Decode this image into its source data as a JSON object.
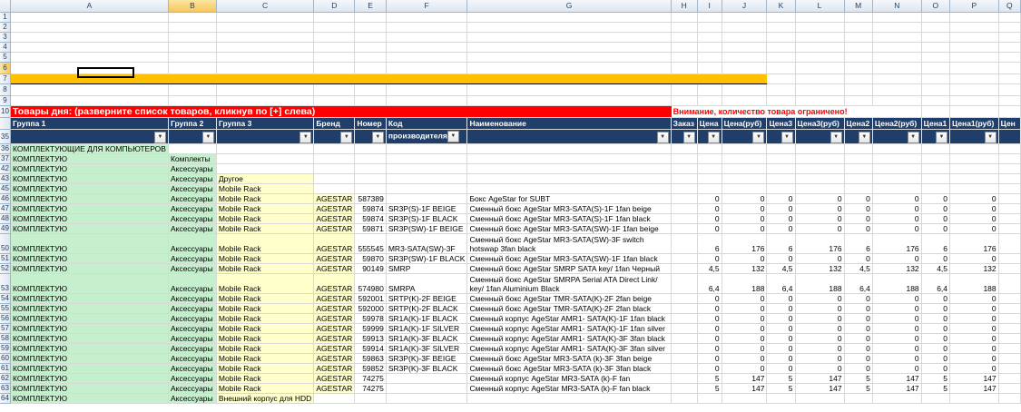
{
  "sheet": {
    "columns": [
      "A",
      "B",
      "C",
      "D",
      "E",
      "F",
      "G",
      "H",
      "I",
      "J",
      "K",
      "L",
      "M",
      "N",
      "O",
      "P",
      "Q"
    ],
    "top_rows": [
      "1",
      "2",
      "3",
      "4",
      "5",
      "6",
      "7",
      "8",
      "9"
    ],
    "banner": {
      "row": "10",
      "title": "Товары дня: (разверните список товаров, кликнув по [+] слева)",
      "warning": "Внимание, количество товара ограничено!"
    },
    "header_row": "35",
    "headers": [
      "Группа 1",
      "Группа 2",
      "Группа 3",
      "Бренд",
      "Номер",
      "Код производителя",
      "Наименование",
      "Заказ",
      "Цена",
      "Цена(руб)",
      "Цена3",
      "Цена3(руб)",
      "Цена2",
      "Цена2(руб)",
      "Цена1",
      "Цена1(руб)",
      "Цен"
    ],
    "filter_glyph": "▼",
    "rows": [
      {
        "n": "36",
        "a": "КОМПЛЕКТУЮЩИЕ ДЛЯ КОМПЬЮТЕРОВ",
        "b": "",
        "c": "",
        "d": "",
        "e": "",
        "f": "",
        "g": "",
        "h": "",
        "v": [
          "",
          "",
          "",
          "",
          "",
          "",
          "",
          ""
        ],
        "lvl": 1
      },
      {
        "n": "37",
        "a": "КОМПЛЕКТУЮ",
        "b": "Комплекты",
        "c": "",
        "d": "",
        "e": "",
        "f": "",
        "g": "",
        "h": "",
        "v": [
          "",
          "",
          "",
          "",
          "",
          "",
          "",
          ""
        ],
        "lvl": 2
      },
      {
        "n": "42",
        "a": "КОМПЛЕКТУЮ",
        "b": "Аксессуары",
        "c": "",
        "d": "",
        "e": "",
        "f": "",
        "g": "",
        "h": "",
        "v": [
          "",
          "",
          "",
          "",
          "",
          "",
          "",
          ""
        ],
        "lvl": 2
      },
      {
        "n": "43",
        "a": "КОМПЛЕКТУЮ",
        "b": "Аксессуары",
        "c": "Другое",
        "d": "",
        "e": "",
        "f": "",
        "g": "",
        "h": "",
        "v": [
          "",
          "",
          "",
          "",
          "",
          "",
          "",
          ""
        ],
        "lvl": 3
      },
      {
        "n": "45",
        "a": "КОМПЛЕКТУЮ",
        "b": "Аксессуары",
        "c": "Mobile Rack",
        "d": "",
        "e": "",
        "f": "",
        "g": "",
        "h": "",
        "v": [
          "",
          "",
          "",
          "",
          "",
          "",
          "",
          ""
        ],
        "lvl": 3
      },
      {
        "n": "46",
        "a": "КОМПЛЕКТУЮ",
        "b": "Аксессуары",
        "c": "Mobile Rack",
        "d": "AGESTAR",
        "e": "587389",
        "f": "",
        "g": "Бокс AgeStar for SUBT",
        "h": "",
        "v": [
          "0",
          "0",
          "0",
          "0",
          "0",
          "0",
          "0",
          "0"
        ],
        "lvl": 4
      },
      {
        "n": "47",
        "a": "КОМПЛЕКТУЮ",
        "b": "Аксессуары",
        "c": "Mobile Rack",
        "d": "AGESTAR",
        "e": "59874",
        "f": "SR3P(S)-1F BEIGE",
        "g": "Сменный бокс AgeStar MR3-SATA(S)-1F 1fan beige",
        "h": "",
        "v": [
          "0",
          "0",
          "0",
          "0",
          "0",
          "0",
          "0",
          "0"
        ],
        "lvl": 4
      },
      {
        "n": "48",
        "a": "КОМПЛЕКТУЮ",
        "b": "Аксессуары",
        "c": "Mobile Rack",
        "d": "AGESTAR",
        "e": "59874",
        "f": "SR3P(S)-1F BLACK",
        "g": "Сменный бокс AgeStar MR3-SATA(S)-1F 1fan black",
        "h": "",
        "v": [
          "0",
          "0",
          "0",
          "0",
          "0",
          "0",
          "0",
          "0"
        ],
        "lvl": 4
      },
      {
        "n": "49",
        "a": "КОМПЛЕКТУЮ",
        "b": "Аксессуары",
        "c": "Mobile Rack",
        "d": "AGESTAR",
        "e": "59871",
        "f": "SR3P(SW)-1F BEIGE",
        "g": "Сменный бокс AgeStar MR3-SATA(SW)-1F 1fan beige",
        "h": "",
        "v": [
          "0",
          "0",
          "0",
          "0",
          "0",
          "0",
          "0",
          "0"
        ],
        "lvl": 4
      },
      {
        "n": "50",
        "a": "КОМПЛЕКТУЮ",
        "b": "Аксессуары",
        "c": "Mobile Rack",
        "d": "AGESTAR",
        "e": "555545",
        "f": "MR3-SATA(SW)-3F",
        "g": "Сменный бокс AgeStar MR3-SATA(SW)-3F switch hotswap 3fan black",
        "h": "",
        "v": [
          "6",
          "176",
          "6",
          "176",
          "6",
          "176",
          "6",
          "176"
        ],
        "lvl": 4,
        "tall": true
      },
      {
        "n": "51",
        "a": "КОМПЛЕКТУЮ",
        "b": "Аксессуары",
        "c": "Mobile Rack",
        "d": "AGESTAR",
        "e": "59870",
        "f": "SR3P(SW)-1F BLACK",
        "g": "Сменный бокс AgeStar MR3-SATA(SW)-1F 1fan black",
        "h": "",
        "v": [
          "0",
          "0",
          "0",
          "0",
          "0",
          "0",
          "0",
          "0"
        ],
        "lvl": 4
      },
      {
        "n": "52",
        "a": "КОМПЛЕКТУЮ",
        "b": "Аксессуары",
        "c": "Mobile Rack",
        "d": "AGESTAR",
        "e": "90149",
        "f": "SMRP",
        "g": "Сменный бокс AgeStar SMRP SATA key/ 1fan Черный",
        "h": "",
        "v": [
          "4,5",
          "132",
          "4,5",
          "132",
          "4,5",
          "132",
          "4,5",
          "132"
        ],
        "lvl": 4
      },
      {
        "n": "53",
        "a": "КОМПЛЕКТУЮ",
        "b": "Аксессуары",
        "c": "Mobile Rack",
        "d": "AGESTAR",
        "e": "574980",
        "f": "SMRPA",
        "g": "Сменный бокс AgeStar SMRPA Serial ATA Direct Link/ key/ 1fan Aluminium Black",
        "h": "",
        "v": [
          "6,4",
          "188",
          "6,4",
          "188",
          "6,4",
          "188",
          "6,4",
          "188"
        ],
        "lvl": 4,
        "tall": true
      },
      {
        "n": "54",
        "a": "КОМПЛЕКТУЮ",
        "b": "Аксессуары",
        "c": "Mobile Rack",
        "d": "AGESTAR",
        "e": "592001",
        "f": "SRTP(K)-2F BEIGE",
        "g": "Сменный бокс AgeStar TMR-SATA(K)-2F 2fan beige",
        "h": "",
        "v": [
          "0",
          "0",
          "0",
          "0",
          "0",
          "0",
          "0",
          "0"
        ],
        "lvl": 4
      },
      {
        "n": "55",
        "a": "КОМПЛЕКТУЮ",
        "b": "Аксессуары",
        "c": "Mobile Rack",
        "d": "AGESTAR",
        "e": "592000",
        "f": "SRTP(K)-2F BLACK",
        "g": "Сменный бокс AgeStar TMR-SATA(K)-2F 2fan black",
        "h": "",
        "v": [
          "0",
          "0",
          "0",
          "0",
          "0",
          "0",
          "0",
          "0"
        ],
        "lvl": 4
      },
      {
        "n": "56",
        "a": "КОМПЛЕКТУЮ",
        "b": "Аксессуары",
        "c": "Mobile Rack",
        "d": "AGESTAR",
        "e": "59978",
        "f": "SR1A(K)-1F BLACK",
        "g": "Сменный корпус AgeStar AMR1- SATA(K)-1F 1fan black",
        "h": "",
        "v": [
          "0",
          "0",
          "0",
          "0",
          "0",
          "0",
          "0",
          "0"
        ],
        "lvl": 4
      },
      {
        "n": "57",
        "a": "КОМПЛЕКТУЮ",
        "b": "Аксессуары",
        "c": "Mobile Rack",
        "d": "AGESTAR",
        "e": "59999",
        "f": "SR1A(K)-1F SILVER",
        "g": "Сменный корпус AgeStar AMR1- SATA(K)-1F 1fan silver",
        "h": "",
        "v": [
          "0",
          "0",
          "0",
          "0",
          "0",
          "0",
          "0",
          "0"
        ],
        "lvl": 4
      },
      {
        "n": "58",
        "a": "КОМПЛЕКТУЮ",
        "b": "Аксессуары",
        "c": "Mobile Rack",
        "d": "AGESTAR",
        "e": "59913",
        "f": "SR1A(K)-3F BLACK",
        "g": "Сменный корпус AgeStar AMR1- SATA(K)-3F 3fan black",
        "h": "",
        "v": [
          "0",
          "0",
          "0",
          "0",
          "0",
          "0",
          "0",
          "0"
        ],
        "lvl": 4
      },
      {
        "n": "59",
        "a": "КОМПЛЕКТУЮ",
        "b": "Аксессуары",
        "c": "Mobile Rack",
        "d": "AGESTAR",
        "e": "59914",
        "f": "SR1A(K)-3F SILVER",
        "g": "Сменный корпус AgeStar AMR1- SATA(K)-3F 3fan silver",
        "h": "",
        "v": [
          "0",
          "0",
          "0",
          "0",
          "0",
          "0",
          "0",
          "0"
        ],
        "lvl": 4
      },
      {
        "n": "60",
        "a": "КОМПЛЕКТУЮ",
        "b": "Аксессуары",
        "c": "Mobile Rack",
        "d": "AGESTAR",
        "e": "59863",
        "f": "SR3P(K)-3F BEIGE",
        "g": "Сменный бокс AgeStar MR3-SATA (k)-3F 3fan beige",
        "h": "",
        "v": [
          "0",
          "0",
          "0",
          "0",
          "0",
          "0",
          "0",
          "0"
        ],
        "lvl": 4
      },
      {
        "n": "61",
        "a": "КОМПЛЕКТУЮ",
        "b": "Аксессуары",
        "c": "Mobile Rack",
        "d": "AGESTAR",
        "e": "59852",
        "f": "SR3P(K)-3F BLACK",
        "g": "Сменный бокс AgeStar MR3-SATA (k)-3F 3fan black",
        "h": "",
        "v": [
          "0",
          "0",
          "0",
          "0",
          "0",
          "0",
          "0",
          "0"
        ],
        "lvl": 4
      },
      {
        "n": "62",
        "a": "КОМПЛЕКТУЮ",
        "b": "Аксессуары",
        "c": "Mobile Rack",
        "d": "AGESTAR",
        "e": "74275",
        "f": "",
        "g": "Сменный корпус AgeStar MR3-SATA (k)-F fan",
        "h": "",
        "v": [
          "5",
          "147",
          "5",
          "147",
          "5",
          "147",
          "5",
          "147"
        ],
        "lvl": 4
      },
      {
        "n": "63",
        "a": "КОМПЛЕКТУЮ",
        "b": "Аксессуары",
        "c": "Mobile Rack",
        "d": "AGESTAR",
        "e": "74275",
        "f": "",
        "g": "Сменный корпус AgeStar MR3-SATA (k)-F fan black",
        "h": "",
        "v": [
          "5",
          "147",
          "5",
          "147",
          "5",
          "147",
          "5",
          "147"
        ],
        "lvl": 4
      },
      {
        "n": "64",
        "a": "КОМПЛЕКТУЮ",
        "b": "Аксессуары",
        "c": "Внешний корпус для HDD",
        "d": "",
        "e": "",
        "f": "",
        "g": "",
        "h": "",
        "v": [
          "",
          "",
          "",
          "",
          "",
          "",
          "",
          ""
        ],
        "lvl": 3
      }
    ]
  },
  "colors": {
    "banner_yellow": "#ffc000",
    "banner_red": "#ff0000",
    "header_navy": "#1f3f6a",
    "group_green": "#c6efce",
    "group_yellow": "#ffffcc"
  }
}
